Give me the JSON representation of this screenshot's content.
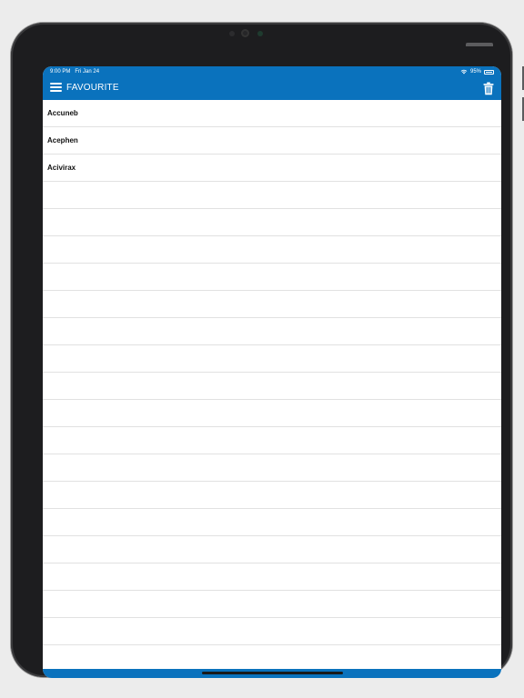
{
  "status_bar": {
    "time": "9:00 PM",
    "date": "Fri Jan 24",
    "battery_percent": "95%",
    "battery_level": 0.95,
    "wifi_icon": "wifi-icon"
  },
  "nav": {
    "title": "FAVOURITE",
    "menu_icon": "hamburger-menu-icon",
    "delete_icon": "trash-icon"
  },
  "favourites": [
    {
      "name": "Accuneb"
    },
    {
      "name": "Acephen"
    },
    {
      "name": "Acivirax"
    },
    {
      "name": ""
    },
    {
      "name": ""
    },
    {
      "name": ""
    },
    {
      "name": ""
    },
    {
      "name": ""
    },
    {
      "name": ""
    },
    {
      "name": ""
    },
    {
      "name": ""
    },
    {
      "name": ""
    },
    {
      "name": ""
    },
    {
      "name": ""
    },
    {
      "name": ""
    },
    {
      "name": ""
    },
    {
      "name": ""
    },
    {
      "name": ""
    },
    {
      "name": ""
    },
    {
      "name": ""
    },
    {
      "name": ""
    }
  ],
  "colors": {
    "primary": "#0a72bd",
    "background": "#ffffff",
    "divider": "#e1e1e1",
    "text": "#111111"
  }
}
